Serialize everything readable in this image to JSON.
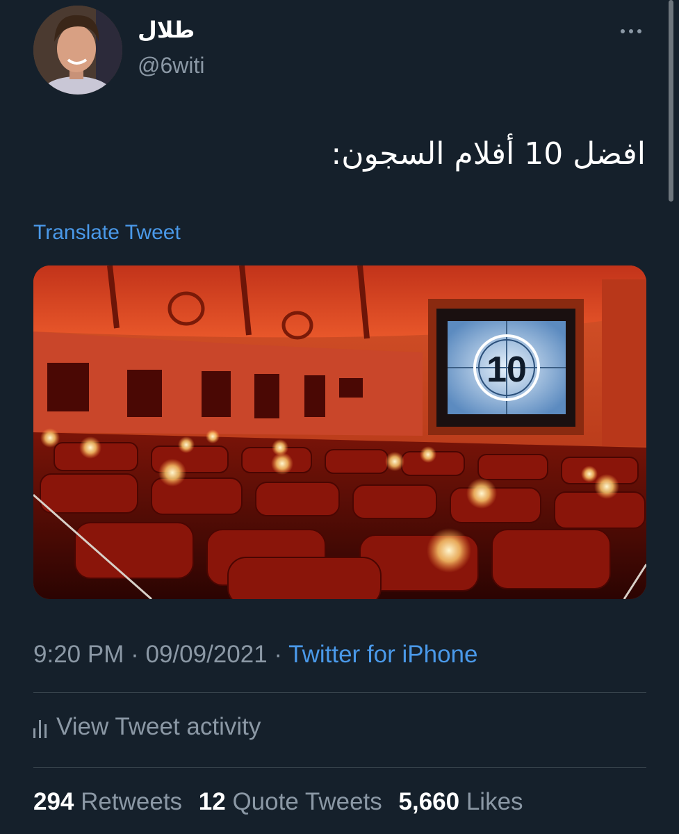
{
  "author": {
    "display_name": "طلال",
    "handle": "@6witi",
    "avatar_icon": "profile-photo"
  },
  "tweet": {
    "text": "افضل 10 أفلام السجون:",
    "translate_label": "Translate Tweet",
    "media": {
      "screen_number": "10"
    }
  },
  "meta": {
    "time": "9:20 PM",
    "separator": "·",
    "date": "09/09/2021",
    "source": "Twitter for iPhone"
  },
  "activity": {
    "label": "View Tweet activity",
    "icon": "bar-chart-icon"
  },
  "stats": {
    "retweets_count": "294",
    "retweets_label": "Retweets",
    "quotes_count": "12",
    "quotes_label": "Quote Tweets",
    "likes_count": "5,660",
    "likes_label": "Likes"
  },
  "colors": {
    "background": "#15202b",
    "accent": "#4a99e9",
    "secondary_text": "#8b98a5"
  }
}
